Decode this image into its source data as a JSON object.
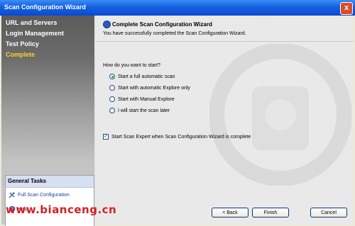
{
  "window": {
    "title": "Scan Configuration Wizard",
    "close_label": "x"
  },
  "sidebar": {
    "items": [
      {
        "label": "URL and Servers",
        "active": false
      },
      {
        "label": "Login Management",
        "active": false
      },
      {
        "label": "Test Policy",
        "active": false
      },
      {
        "label": "Complete",
        "active": true
      }
    ]
  },
  "general_tasks": {
    "title": "General Tasks",
    "items": [
      {
        "label": "Full Scan Configuration"
      },
      {
        "label": "Help"
      }
    ]
  },
  "main": {
    "title": "Complete Scan Configuration Wizard",
    "subtitle": "You have successfully completed the Scan Configuration Wizard.",
    "question": "How do you want to start?",
    "options": [
      {
        "label": "Start a full automatic scan",
        "selected": true
      },
      {
        "label": "Start with automatic Explore only",
        "selected": false
      },
      {
        "label": "Start with Manual Explore",
        "selected": false
      },
      {
        "label": "I will start the scan later",
        "selected": false
      }
    ],
    "checkbox": {
      "label": "Start Scan Expert when Scan Configuration Wizard is complete",
      "checked": true
    }
  },
  "buttons": {
    "back": "< Back",
    "finish": "Finish",
    "cancel": "Cancel"
  },
  "watermark": "www.bianceng.cn"
}
